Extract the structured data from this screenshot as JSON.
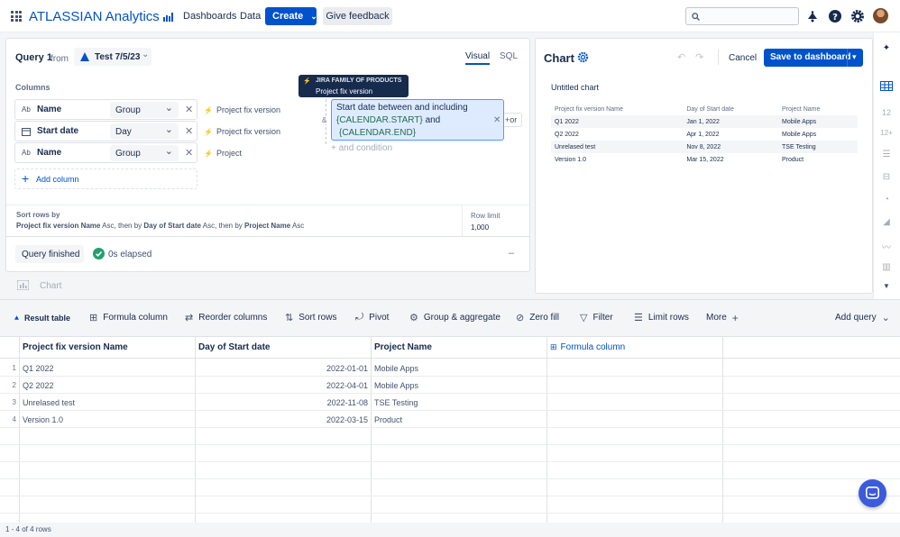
{
  "topnav": {
    "brand": "ATLASSIAN Analytics",
    "links": [
      "Dashboards",
      "Data"
    ],
    "create_label": "Create",
    "feedback_label": "Give feedback",
    "search_placeholder": ""
  },
  "query": {
    "title": "Query 1",
    "from_label": "from",
    "source_name": "Test 7/5/23",
    "mode_tabs": [
      "Visual",
      "SQL"
    ],
    "active_mode": "Visual",
    "columns_label": "Columns",
    "columns": [
      {
        "type_icon": "Ab",
        "name": "Name",
        "agg": "Group",
        "source": "Project fix version"
      },
      {
        "type_icon": "calendar-icon",
        "name": "Start date",
        "agg": "Day",
        "source": "Project fix version"
      },
      {
        "type_icon": "Ab",
        "name": "Name",
        "agg": "Group",
        "source": "Project"
      }
    ],
    "add_column_label": "Add column",
    "tooltip": {
      "title": "JIRA FAMILY OF PRODUCTS",
      "subtitle": "Project fix version"
    },
    "condition": {
      "prefix": "Start date between and including",
      "start_token": "{CALENDAR.START}",
      "joiner": "and",
      "end_token": "{CALENDAR.END}",
      "and_symbol": "&",
      "or_label": "+or",
      "add_condition_label": "+ and condition"
    },
    "sort": {
      "label": "Sort rows by",
      "parts": [
        {
          "text": "Project fix version Name",
          "bold": true
        },
        {
          "text": " Asc, then by ",
          "bold": false
        },
        {
          "text": "Day of Start date",
          "bold": true
        },
        {
          "text": " Asc, then by ",
          "bold": false
        },
        {
          "text": "Project Name",
          "bold": true
        },
        {
          "text": " Asc",
          "bold": false
        }
      ]
    },
    "row_limit": {
      "label": "Row limit",
      "value": "1,000"
    },
    "status_label": "Query finished",
    "elapsed": "0s elapsed",
    "collapse_symbol": "–"
  },
  "chart_panel": {
    "title": "Chart",
    "cancel_label": "Cancel",
    "save_label": "Save to dashboard",
    "chart_title": "Untitled chart",
    "headers": [
      "Project fix version Name",
      "Day of Start date",
      "Project Name"
    ],
    "rows": [
      [
        "Q1 2022",
        "Jan 1, 2022",
        "Mobile Apps"
      ],
      [
        "Q2 2022",
        "Apr 1, 2022",
        "Mobile Apps"
      ],
      [
        "Unrelased test",
        "Nov 8, 2022",
        "TSE Testing"
      ],
      [
        "Version 1.0",
        "Mar 15, 2022",
        "Product"
      ]
    ]
  },
  "chart_step_label": "Chart",
  "toolbar": {
    "result_table": "Result table",
    "formula_column": "Formula column",
    "reorder_columns": "Reorder columns",
    "sort_rows": "Sort rows",
    "pivot": "Pivot",
    "group_aggregate": "Group & aggregate",
    "zero_fill": "Zero fill",
    "filter": "Filter",
    "limit_rows": "Limit rows",
    "more": "More",
    "add_query": "Add query"
  },
  "result_table": {
    "headers": [
      "Project fix version Name",
      "Day of Start date",
      "Project Name",
      "Formula column"
    ],
    "rows": [
      {
        "num": "1",
        "cells": [
          "Q1 2022",
          "2022-01-01",
          "Mobile Apps"
        ]
      },
      {
        "num": "2",
        "cells": [
          "Q2 2022",
          "2022-04-01",
          "Mobile Apps"
        ]
      },
      {
        "num": "3",
        "cells": [
          "Unrelased test",
          "2022-11-08",
          "TSE Testing"
        ]
      },
      {
        "num": "4",
        "cells": [
          "Version 1.0",
          "2022-03-15",
          "Product"
        ]
      }
    ]
  },
  "side_rail": {
    "icon_12": "12",
    "icon_12plus": "12+"
  },
  "status_bar": "1 - 4 of 4 rows",
  "colors": {
    "brand": "#0052cc",
    "success": "#22a06b",
    "condition_bg": "#deebff"
  }
}
